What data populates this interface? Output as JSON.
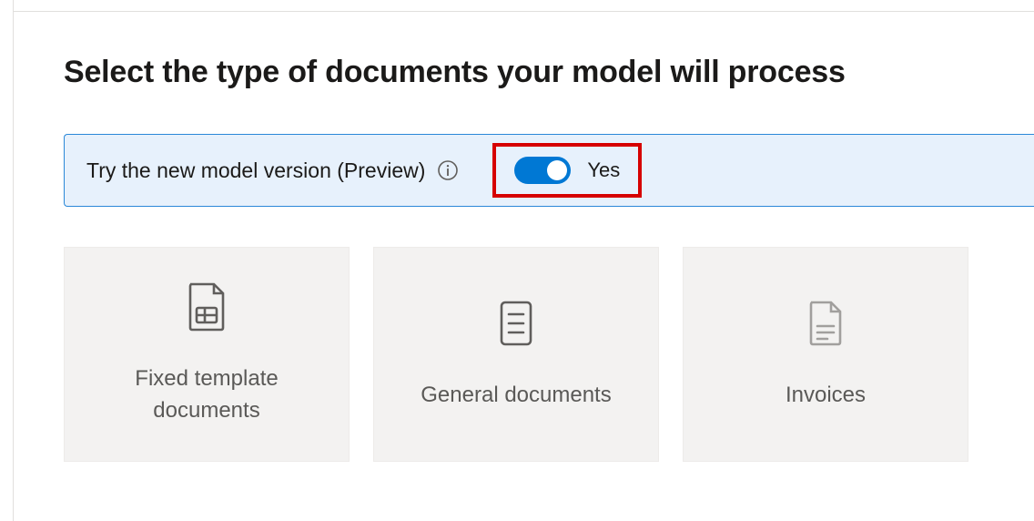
{
  "page": {
    "title": "Select the type of documents your model will process"
  },
  "preview_banner": {
    "label": "Try the new model version (Preview)",
    "toggle_state": "Yes"
  },
  "cards": [
    {
      "label": "Fixed template documents",
      "icon": "page-grid-icon"
    },
    {
      "label": "General documents",
      "icon": "page-lines-icon"
    },
    {
      "label": "Invoices",
      "icon": "page-invoice-icon"
    }
  ]
}
